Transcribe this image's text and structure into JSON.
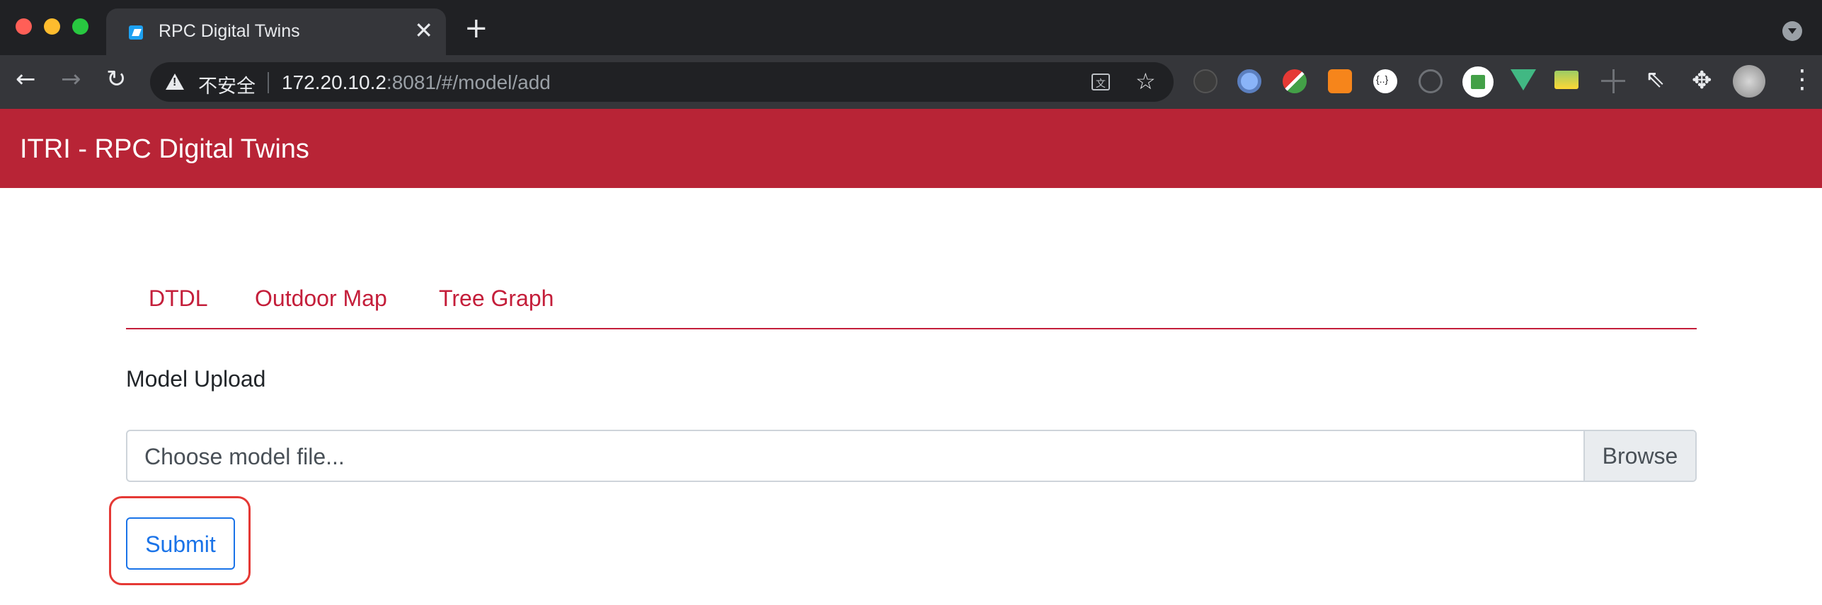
{
  "browser": {
    "tab": {
      "title": "RPC Digital Twins",
      "close_glyph": "✕"
    },
    "new_tab_glyph": "+",
    "nav": {
      "back_glyph": "←",
      "forward_glyph": "→",
      "reload_glyph": "↻"
    },
    "address": {
      "security_label": "不安全",
      "url_host": "172.20.10.2",
      "url_rest": ":8081/#/model/add"
    },
    "icons": {
      "translate": "translate-icon",
      "bookmark": "star-icon",
      "extensions": "puzzle-icon",
      "menu": "more-vert-icon"
    },
    "star_glyph": "☆",
    "cursor_glyph": "⇖",
    "puzzle_glyph": "✥",
    "menu_glyph": "⋮",
    "translate_glyph": "文"
  },
  "app": {
    "title": "ITRI - RPC Digital Twins",
    "header_color": "#b82436",
    "tabs": [
      {
        "label": "DTDL"
      },
      {
        "label": "Outdoor Map"
      },
      {
        "label": "Tree Graph"
      }
    ],
    "section_label": "Model Upload",
    "file_input": {
      "placeholder": "Choose model file...",
      "browse_label": "Browse"
    },
    "submit_label": "Submit",
    "accent_color": "#c41e3a",
    "highlight_color": "#e53935"
  }
}
